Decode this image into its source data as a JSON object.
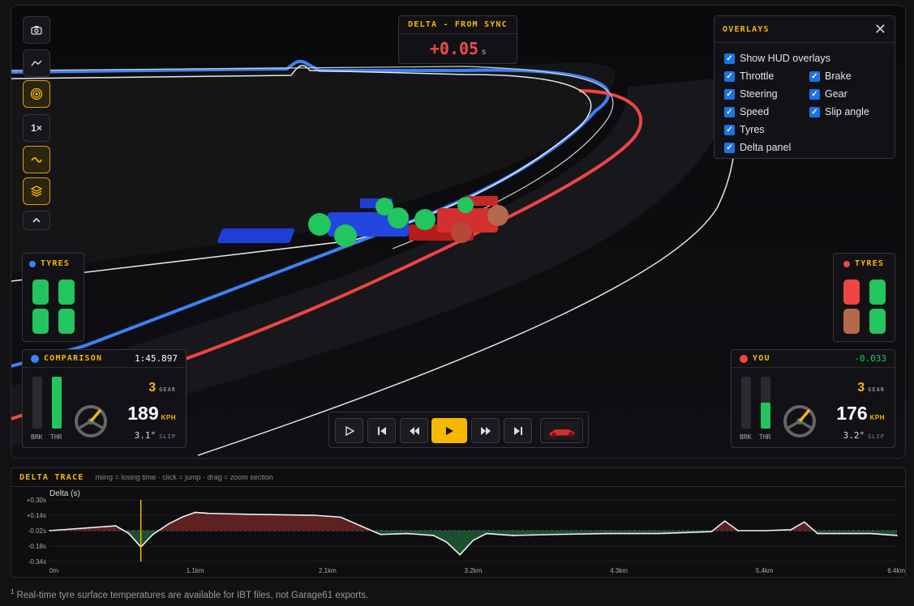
{
  "toolbar": {
    "items": [
      {
        "icon": "camera-icon",
        "active": false
      },
      {
        "icon": "trace-line-icon",
        "active": false
      },
      {
        "icon": "target-icon",
        "active": true
      },
      {
        "label": "1×",
        "active": false
      },
      {
        "icon": "path-icon",
        "active": true
      },
      {
        "icon": "layers-icon",
        "active": true
      },
      {
        "icon": "chevron-up-icon",
        "active": false
      }
    ]
  },
  "delta_panel": {
    "title": "DELTA - FROM SYNC",
    "value": "+0.05",
    "unit": "s",
    "color": "#ef4a4a"
  },
  "overlays": {
    "title": "OVERLAYS",
    "options": [
      {
        "label": "Show HUD overlays",
        "checked": true
      },
      {
        "label": "Throttle",
        "checked": true
      },
      {
        "label": "Brake",
        "checked": true
      },
      {
        "label": "Steering",
        "checked": true
      },
      {
        "label": "Gear",
        "checked": true
      },
      {
        "label": "Speed",
        "checked": true
      },
      {
        "label": "Slip angle",
        "checked": true
      },
      {
        "label": "Tyres",
        "checked": true
      },
      {
        "label": "Delta panel",
        "checked": true
      }
    ]
  },
  "tyres_left": {
    "title": "TYRES",
    "dot_color": "#3b82f6",
    "tyres": [
      "#22c55e",
      "#22c55e",
      "#22c55e",
      "#22c55e"
    ]
  },
  "tyres_right": {
    "title": "TYRES",
    "dot_color": "#ef4444",
    "tyres": [
      "#ef4444",
      "#22c55e",
      "#b46a4a",
      "#22c55e"
    ]
  },
  "comparison": {
    "title": "COMPARISON",
    "dot_color": "#3b82f6",
    "right_value": "1:45.897",
    "brake": 0,
    "throttle": 1.0,
    "gear": "3",
    "gear_label": "GEAR",
    "speed": "189",
    "speed_unit": "KPH",
    "slip": "3.1°",
    "slip_label": "SLIP",
    "brk_label": "BRK",
    "thr_label": "THR"
  },
  "you": {
    "title": "YOU",
    "dot_color": "#ef4444",
    "right_value": "-0.033",
    "right_color": "#22c55e",
    "brake": 0,
    "throttle": 0.5,
    "gear": "3",
    "gear_label": "GEAR",
    "speed": "176",
    "speed_unit": "KPH",
    "slip": "3.2°",
    "slip_label": "SLIP",
    "brk_label": "BRK",
    "thr_label": "THR"
  },
  "delta_trace": {
    "title": "DELTA TRACE",
    "hint": "rising = losing time · click = jump · drag = zoom section",
    "ylabel": "Delta (s)",
    "yticks": [
      "+0.30s",
      "+0.14s",
      "-0.02s",
      "-0.18s",
      "-0.34s"
    ],
    "xticks": [
      "0m",
      "1.1km",
      "2.1km",
      "3.2km",
      "4.3km",
      "5.4km",
      "6.4km"
    ],
    "cursor_km": 0.69
  },
  "chart_data": {
    "type": "area",
    "title": "",
    "ylabel": "Delta (s)",
    "xlabel": "",
    "xlim": [
      0,
      6.4
    ],
    "ylim": [
      -0.34,
      0.3
    ],
    "series": [
      {
        "x": [
          0,
          0.3,
          0.5,
          0.6,
          0.69,
          0.78,
          0.9,
          1.0,
          1.1,
          1.2,
          1.5,
          2.0,
          2.2,
          2.4,
          2.5,
          2.7,
          2.9,
          3.0,
          3.1,
          3.2,
          3.3,
          3.5,
          3.8,
          4.2,
          4.6,
          5.0,
          5.1,
          5.2,
          5.4,
          5.6,
          5.7,
          5.8,
          6.0,
          6.2,
          6.4
        ],
        "y": [
          -0.02,
          0.01,
          0.03,
          -0.05,
          -0.19,
          -0.06,
          0.05,
          0.12,
          0.17,
          0.16,
          0.15,
          0.14,
          0.12,
          0.0,
          -0.06,
          -0.05,
          -0.07,
          -0.14,
          -0.27,
          -0.12,
          -0.05,
          -0.07,
          -0.06,
          -0.05,
          -0.05,
          -0.03,
          0.08,
          -0.02,
          -0.02,
          -0.01,
          0.07,
          -0.05,
          -0.05,
          -0.05,
          -0.07
        ]
      }
    ]
  }
}
